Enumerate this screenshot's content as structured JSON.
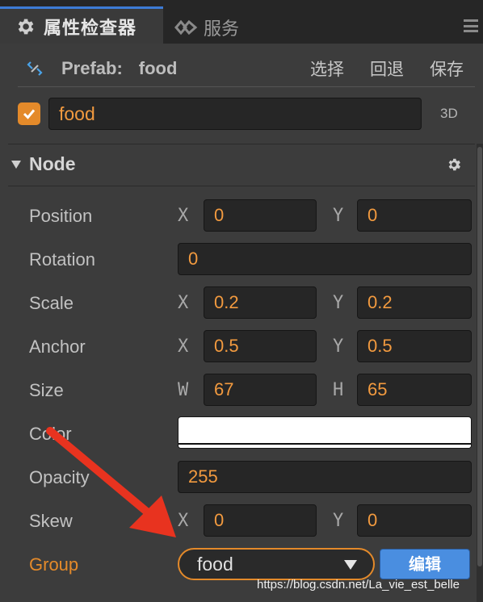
{
  "tabs": {
    "active_label": "属性检查器",
    "inactive_label": "服务"
  },
  "prefab": {
    "title": "Prefab:",
    "name": "food",
    "actions": [
      "选择",
      "回退",
      "保存"
    ]
  },
  "node_name": {
    "checked": true,
    "value": "food",
    "mode_label": "3D"
  },
  "node_section": {
    "title": "Node"
  },
  "properties": {
    "position": {
      "label": "Position",
      "x_axis": "X",
      "x": "0",
      "y_axis": "Y",
      "y": "0"
    },
    "rotation": {
      "label": "Rotation",
      "value": "0"
    },
    "scale": {
      "label": "Scale",
      "x_axis": "X",
      "x": "0.2",
      "y_axis": "Y",
      "y": "0.2"
    },
    "anchor": {
      "label": "Anchor",
      "x_axis": "X",
      "x": "0.5",
      "y_axis": "Y",
      "y": "0.5"
    },
    "size": {
      "label": "Size",
      "w_axis": "W",
      "w": "67",
      "h_axis": "H",
      "h": "65"
    },
    "color": {
      "label": "Color",
      "value": "#ffffff"
    },
    "opacity": {
      "label": "Opacity",
      "value": "255"
    },
    "skew": {
      "label": "Skew",
      "x_axis": "X",
      "x": "0",
      "y_axis": "Y",
      "y": "0"
    },
    "group": {
      "label": "Group",
      "value": "food",
      "edit_label": "编辑"
    }
  },
  "watermark": "https://blog.csdn.net/La_vie_est_belle",
  "colors": {
    "accent_orange": "#e48a2a",
    "value_orange": "#f29a3f",
    "active_tab_blue": "#3d7bd6",
    "edit_button_blue": "#4a8ee0",
    "annotation_arrow": "#e8331f"
  },
  "icons": {
    "inspector_tab": "gear-icon",
    "service_tab": "link-icon",
    "prefab": "prefab-link-icon",
    "node_settings": "gear-icon",
    "menu": "hamburger-icon"
  }
}
